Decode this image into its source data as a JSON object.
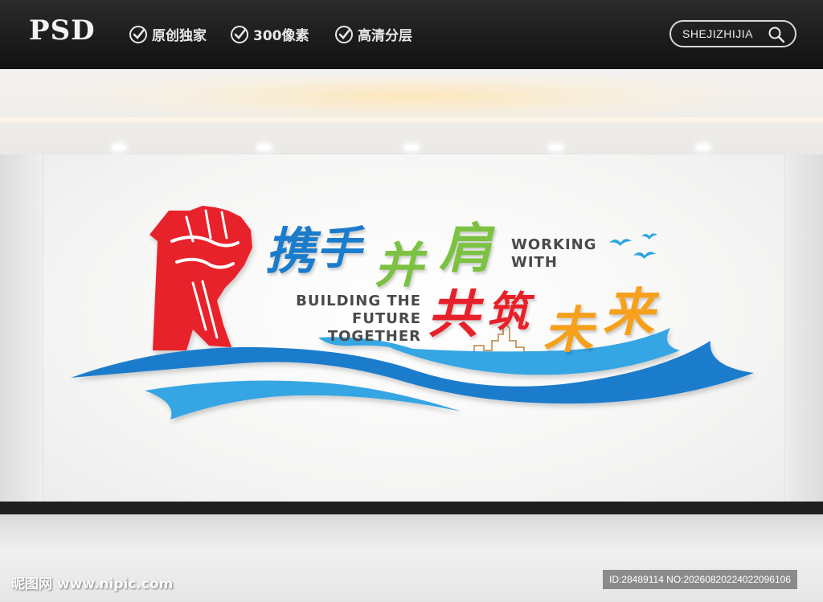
{
  "header": {
    "logo": "PSD",
    "features": [
      "原创独家",
      "300像素",
      "高清分层"
    ],
    "search_text": "SHEJIZHIJIA"
  },
  "artwork": {
    "line1_chars": [
      "携",
      "手",
      "并",
      "肩"
    ],
    "line2_chars": [
      "共",
      "筑",
      "未",
      "来"
    ],
    "en_right": [
      "WORKING",
      "WITH"
    ],
    "en_left": [
      "BUILDING THE",
      "FUTURE TOGETHER"
    ]
  },
  "colors": {
    "blue": "#1b7ccc",
    "light_blue": "#36a6e3",
    "green": "#7cc242",
    "red": "#e8202a",
    "orange": "#f6a01c",
    "skyline": "#c8a070"
  },
  "watermark": {
    "left": "昵图网 www.nipic.com",
    "right": "ID:28489114 NO:20260820224022096106"
  }
}
